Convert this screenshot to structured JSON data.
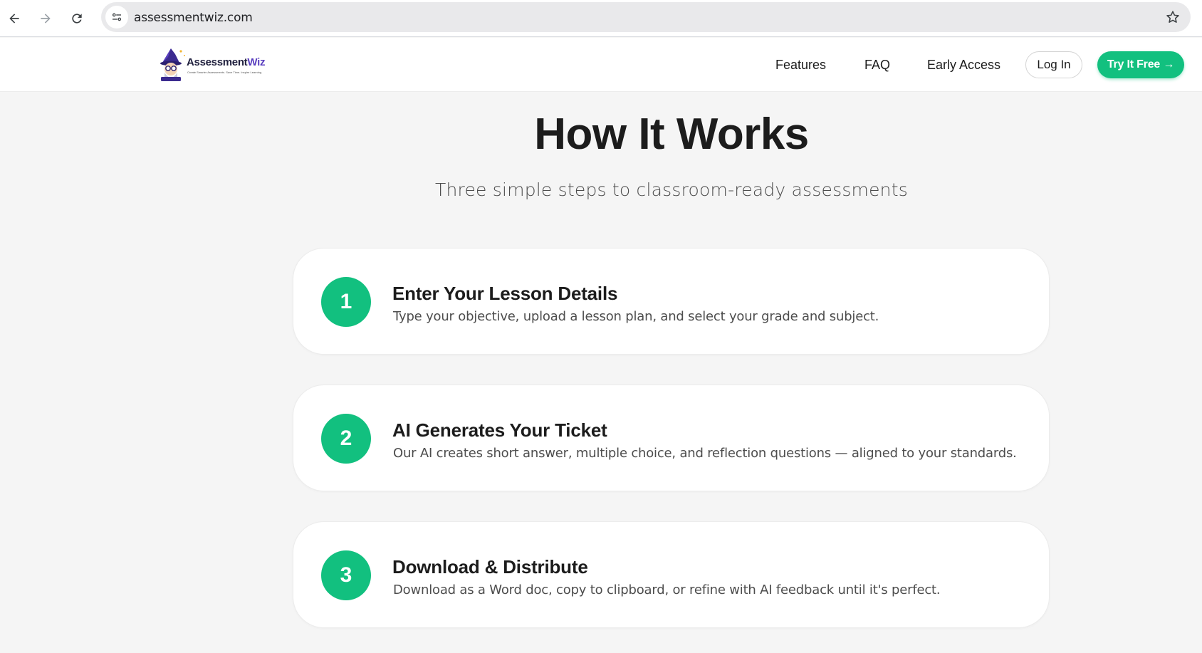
{
  "browser": {
    "url": "assessmentwiz.com"
  },
  "header": {
    "logo": {
      "name_part1": "Assessment",
      "name_part2": "Wiz",
      "tagline": "Create Smarter Assessments. Save Time. Inspire Learning."
    },
    "nav": [
      {
        "label": "Features"
      },
      {
        "label": "FAQ"
      },
      {
        "label": "Early Access"
      }
    ],
    "login_label": "Log In",
    "try_label": "Try It Free →"
  },
  "main": {
    "title": "How It Works",
    "subtitle": "Three simple steps to classroom-ready assessments",
    "steps": [
      {
        "number": "1",
        "title": "Enter Your Lesson Details",
        "description": "Type your objective, upload a lesson plan, and select your grade and subject."
      },
      {
        "number": "2",
        "title": "AI Generates Your Ticket",
        "description": "Our AI creates short answer, multiple choice, and reflection questions — aligned to your standards."
      },
      {
        "number": "3",
        "title": "Download & Distribute",
        "description": "Download as a Word doc, copy to clipboard, or refine with AI feedback until it's perfect."
      }
    ]
  },
  "colors": {
    "accent": "#12c07f",
    "brand_purple": "#5a3fbf"
  },
  "icons": [
    "back-arrow-icon",
    "forward-arrow-icon",
    "reload-icon",
    "site-settings-icon",
    "bookmark-star-icon",
    "wizard-logo-icon"
  ]
}
